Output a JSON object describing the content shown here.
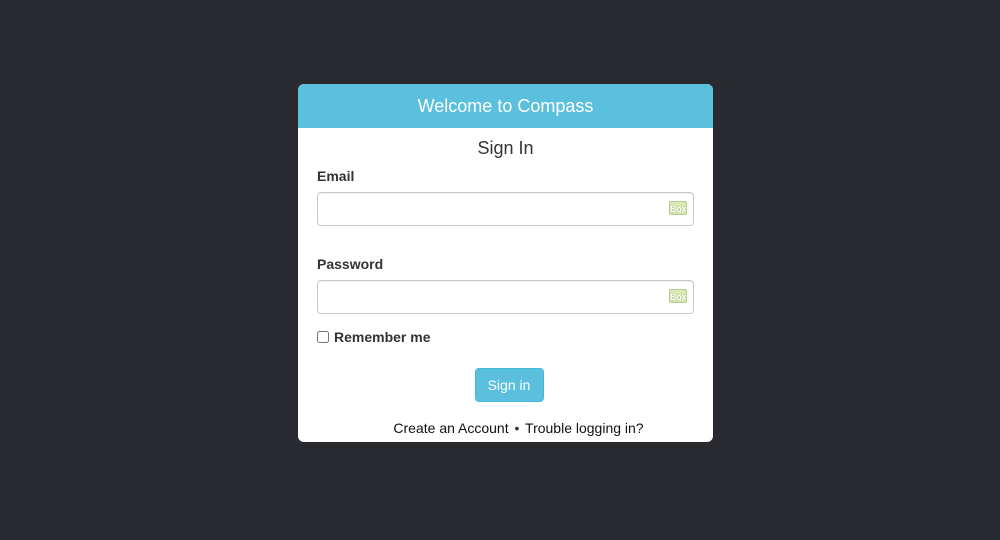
{
  "header": {
    "title": "Welcome to Compass"
  },
  "form": {
    "title": "Sign In",
    "email_label": "Email",
    "email_value": "",
    "email_icon": "Box",
    "password_label": "Password",
    "password_value": "",
    "password_icon": "Box",
    "remember_label": "Remember me",
    "remember_checked": false,
    "submit_label": "Sign in"
  },
  "footer": {
    "create_account": "Create an Account",
    "separator": "•",
    "trouble": "Trouble logging in?"
  },
  "colors": {
    "background": "#282a2f",
    "accent": "#5bc0de",
    "card": "#ffffff"
  }
}
